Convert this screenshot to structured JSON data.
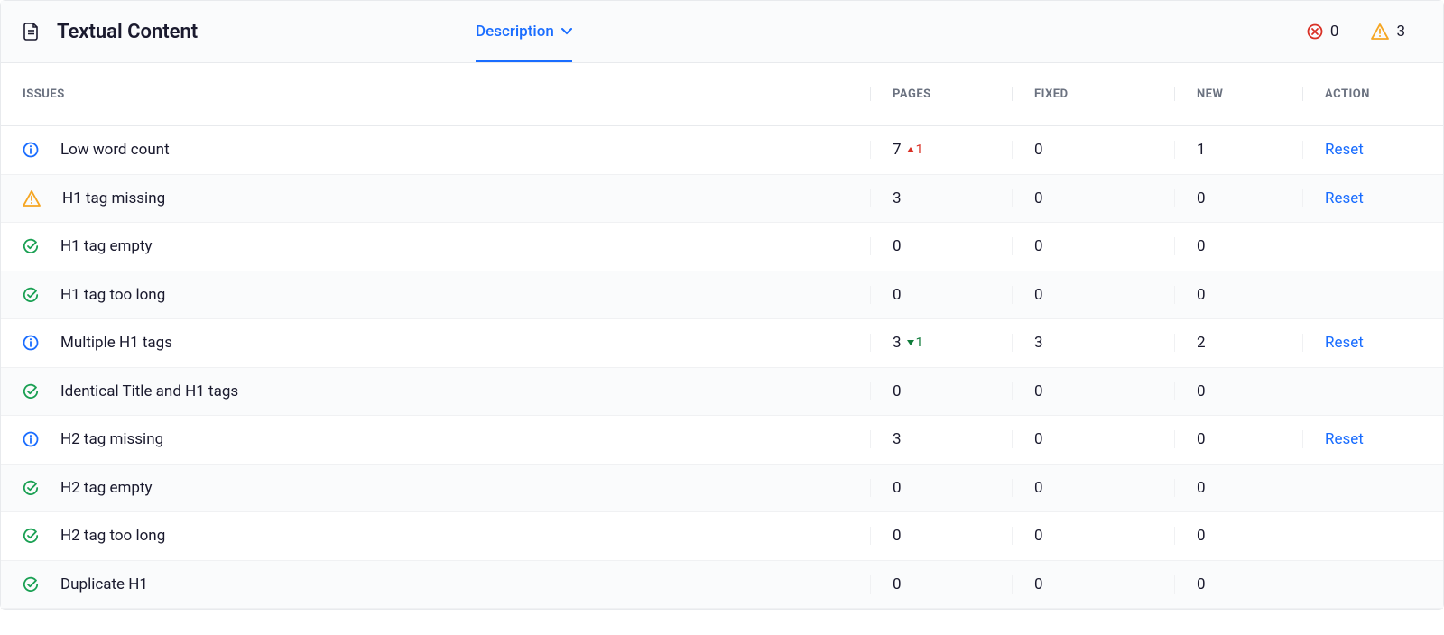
{
  "header": {
    "title": "Textual Content",
    "tab_label": "Description",
    "error_count": "0",
    "warning_count": "3"
  },
  "columns": {
    "issues": "Issues",
    "pages": "Pages",
    "fixed": "Fixed",
    "new": "New",
    "action": "Action"
  },
  "action_label": "Reset",
  "rows": [
    {
      "icon": "info",
      "name": "Low word count",
      "pages": "7",
      "delta": {
        "dir": "up",
        "value": "1"
      },
      "fixed": "0",
      "new": "1",
      "action": true
    },
    {
      "icon": "warning",
      "name": "H1 tag missing",
      "pages": "3",
      "delta": null,
      "fixed": "0",
      "new": "0",
      "action": true
    },
    {
      "icon": "check",
      "name": "H1 tag empty",
      "pages": "0",
      "delta": null,
      "fixed": "0",
      "new": "0",
      "action": false
    },
    {
      "icon": "check",
      "name": "H1 tag too long",
      "pages": "0",
      "delta": null,
      "fixed": "0",
      "new": "0",
      "action": false
    },
    {
      "icon": "info",
      "name": "Multiple H1 tags",
      "pages": "3",
      "delta": {
        "dir": "down",
        "value": "1"
      },
      "fixed": "3",
      "new": "2",
      "action": true
    },
    {
      "icon": "check",
      "name": "Identical Title and H1 tags",
      "pages": "0",
      "delta": null,
      "fixed": "0",
      "new": "0",
      "action": false
    },
    {
      "icon": "info",
      "name": "H2 tag missing",
      "pages": "3",
      "delta": null,
      "fixed": "0",
      "new": "0",
      "action": true
    },
    {
      "icon": "check",
      "name": "H2 tag empty",
      "pages": "0",
      "delta": null,
      "fixed": "0",
      "new": "0",
      "action": false
    },
    {
      "icon": "check",
      "name": "H2 tag too long",
      "pages": "0",
      "delta": null,
      "fixed": "0",
      "new": "0",
      "action": false
    },
    {
      "icon": "check",
      "name": "Duplicate H1",
      "pages": "0",
      "delta": null,
      "fixed": "0",
      "new": "0",
      "action": false
    }
  ]
}
